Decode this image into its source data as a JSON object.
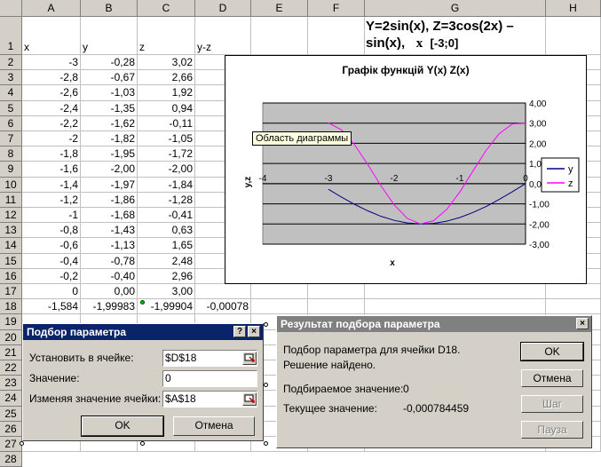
{
  "columns": [
    "A",
    "B",
    "C",
    "D",
    "E",
    "F",
    "G",
    "H"
  ],
  "rows": [
    "1",
    "2",
    "3",
    "4",
    "5",
    "6",
    "7",
    "8",
    "9",
    "10",
    "11",
    "12",
    "13",
    "14",
    "15",
    "16",
    "17",
    "18",
    "19",
    "20",
    "21",
    "22",
    "23",
    "24",
    "25",
    "26",
    "27",
    "28"
  ],
  "table_headers": [
    "x",
    "y",
    "z",
    "y-z"
  ],
  "table_rows": [
    [
      "-3",
      "-0,28",
      "3,02"
    ],
    [
      "-2,8",
      "-0,67",
      "2,66"
    ],
    [
      "-2,6",
      "-1,03",
      "1,92"
    ],
    [
      "-2,4",
      "-1,35",
      "0,94"
    ],
    [
      "-2,2",
      "-1,62",
      "-0,11"
    ],
    [
      "-2",
      "-1,82",
      "-1,05"
    ],
    [
      "-1,8",
      "-1,95",
      "-1,72"
    ],
    [
      "-1,6",
      "-2,00",
      "-2,00"
    ],
    [
      "-1,4",
      "-1,97",
      "-1,84"
    ],
    [
      "-1,2",
      "-1,86",
      "-1,28"
    ],
    [
      "-1",
      "-1,68",
      "-0,41"
    ],
    [
      "-0,8",
      "-1,43",
      "0,63"
    ],
    [
      "-0,6",
      "-1,13",
      "1,65"
    ],
    [
      "-0,4",
      "-0,78",
      "2,48"
    ],
    [
      "-0,2",
      "-0,40",
      "2,96"
    ],
    [
      "0",
      "0,00",
      "3,00"
    ]
  ],
  "row18": [
    "-1,584",
    "-1,99983",
    "-1,99904",
    "-0,00078"
  ],
  "formula_text": {
    "line1": "Y=2sin(x),     Z=3cos(2x) –",
    "line2a": "sin(x),",
    "line2b": "x",
    "line2c": "[-3;0]"
  },
  "chart_data": {
    "type": "line",
    "title": "Графік функцій Y(x) Z(x)",
    "xlabel": "x",
    "ylabel": "y,z",
    "xlim": [
      -4,
      0
    ],
    "ylim": [
      -3,
      4
    ],
    "x_ticks": [
      "-4",
      "-3",
      "-2",
      "-1",
      "0"
    ],
    "y_ticks": [
      "4,00",
      "3,00",
      "2,00",
      "1,00",
      "0,00",
      "-1,00",
      "-2,00",
      "-3,00"
    ],
    "x": [
      -3,
      -2.8,
      -2.6,
      -2.4,
      -2.2,
      -2,
      -1.8,
      -1.6,
      -1.4,
      -1.2,
      -1,
      -0.8,
      -0.6,
      -0.4,
      -0.2,
      0
    ],
    "series": [
      {
        "name": "y",
        "color": "#000080",
        "values": [
          -0.28,
          -0.67,
          -1.03,
          -1.35,
          -1.62,
          -1.82,
          -1.95,
          -2.0,
          -1.97,
          -1.86,
          -1.68,
          -1.43,
          -1.13,
          -0.78,
          -0.4,
          0.0
        ]
      },
      {
        "name": "z",
        "color": "#ff00ff",
        "values": [
          3.02,
          2.66,
          1.92,
          0.94,
          -0.11,
          -1.05,
          -1.72,
          -2.0,
          -1.84,
          -1.28,
          -0.41,
          0.63,
          1.65,
          2.48,
          2.96,
          3.0
        ]
      }
    ],
    "plot_area_color": "#c0c0c0",
    "grid": true,
    "legend": "right"
  },
  "tooltip": "Область диаграммы",
  "goal_seek": {
    "title": "Подбор параметра",
    "help": "?",
    "close": "×",
    "set_cell_label": "Установить в ячейке:",
    "set_cell_value": "$D$18",
    "value_label": "Значение:",
    "value_value": "0",
    "changing_label": "Изменяя значение ячейки:",
    "changing_value": "$A$18",
    "ok": "OK",
    "cancel": "Отмена"
  },
  "result": {
    "title": "Результат подбора параметра",
    "close": "×",
    "line1": "Подбор параметра для ячейки D18.",
    "line2": "Решение найдено.",
    "target_label": "Подбираемое значение:",
    "target_value": "0",
    "current_label": "Текущее значение:",
    "current_value": "-0,000784459",
    "ok": "OK",
    "cancel": "Отмена",
    "step": "Шаг",
    "pause": "Пауза"
  },
  "colors": {
    "title_active": "#0a246a",
    "title_inactive": "#808080",
    "face": "#d4d0c8"
  }
}
